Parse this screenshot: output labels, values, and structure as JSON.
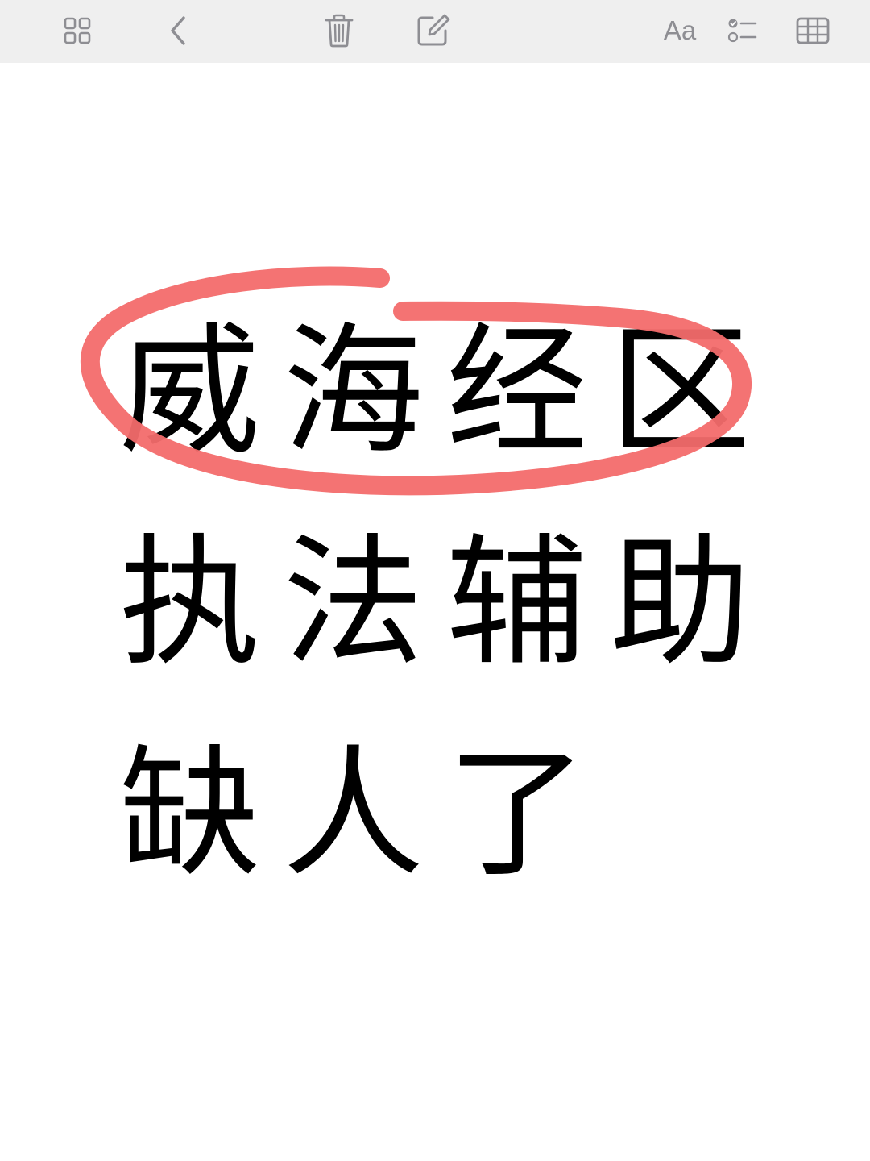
{
  "toolbar": {
    "buttons": [
      {
        "name": "gallery-view-button",
        "icon": "gallery-grid-icon"
      },
      {
        "name": "back-button",
        "icon": "chevron-left-icon"
      },
      {
        "name": "delete-button",
        "icon": "trash-icon"
      },
      {
        "name": "compose-button",
        "icon": "compose-icon"
      },
      {
        "name": "format-button",
        "icon": "text-format-icon",
        "label": "Aa"
      },
      {
        "name": "checklist-button",
        "icon": "checklist-icon"
      },
      {
        "name": "table-button",
        "icon": "table-icon"
      }
    ],
    "icon_color": "#8e8e93",
    "background": "#efefef"
  },
  "note": {
    "lines": [
      "威海经区",
      "执法辅助",
      "缺人了"
    ],
    "text_color": "#000000",
    "annotation": {
      "shape": "hand-drawn-ellipse",
      "color": "#f36b6b",
      "encircles_line": 1
    }
  }
}
